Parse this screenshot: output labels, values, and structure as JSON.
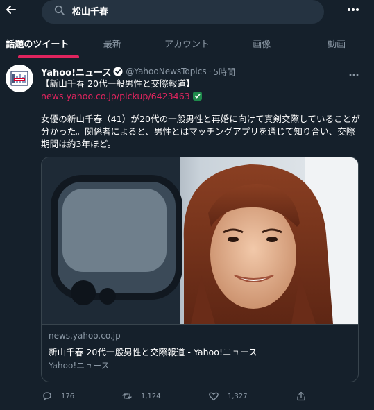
{
  "search": {
    "query": "松山千春"
  },
  "tabs": [
    {
      "label": "話題のツイート",
      "active": true
    },
    {
      "label": "最新",
      "active": false
    },
    {
      "label": "アカウント",
      "active": false
    },
    {
      "label": "画像",
      "active": false
    },
    {
      "label": "動画",
      "active": false
    }
  ],
  "tweet": {
    "author_name": "Yahoo!ニュース",
    "handle": "@YahooNewsTopics",
    "separator": "·",
    "time": "5時間",
    "headline": "【新山千春 20代一般男性と交際報道】",
    "link": "news.yahoo.co.jp/pickup/6423463",
    "body_lines": [
      "女優の新山千春（41）が20代の一般男性と再婚に向けて真剣交際していることが",
      "分かった。関係者によると、男性とはマッチングアプリを通じて知り合い、交際",
      "期間は約3年ほど。"
    ],
    "card": {
      "domain": "news.yahoo.co.jp",
      "title": "新山千春 20代一般男性と交際報道 - Yahoo!ニュース",
      "source": "Yahoo!ニュース"
    },
    "actions": {
      "reply_count": "176",
      "retweet_count": "1,124",
      "like_count": "1,327"
    }
  },
  "colors": {
    "background": "#15202b",
    "accent": "#e0245e",
    "muted_text": "#8b98a5",
    "border": "#38444d",
    "verified": "#1da1f2"
  }
}
